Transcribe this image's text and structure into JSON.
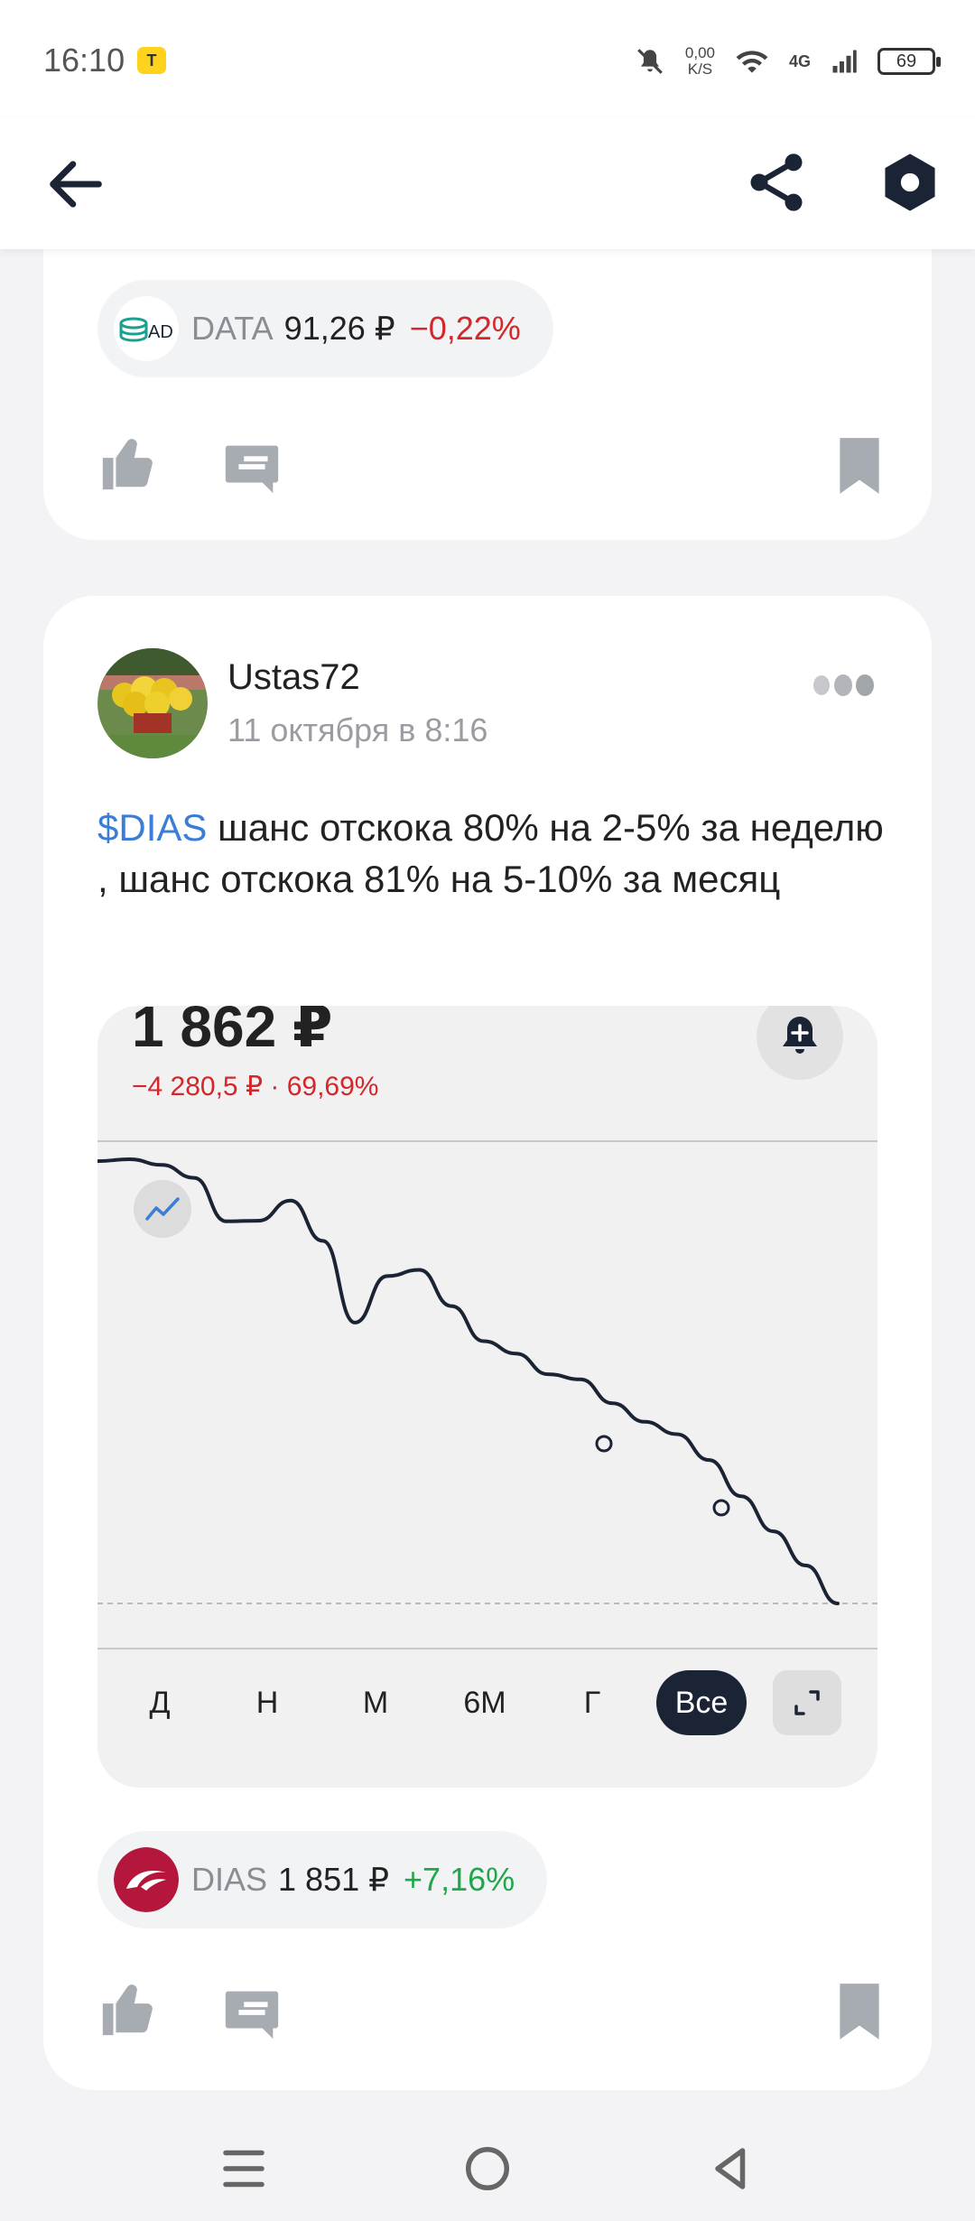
{
  "status_bar": {
    "time": "16:10",
    "net_speed_value": "0,00",
    "net_speed_unit": "K/S",
    "network_type": "4G",
    "battery": "69"
  },
  "toolbar": {
    "back_icon": "arrow-left-icon",
    "share_icon": "share-icon",
    "settings_icon": "hexagon-settings-icon"
  },
  "previous_post": {
    "ticker": {
      "name": "DATA",
      "price": "91,26 ₽",
      "change": "−0,22%",
      "change_color": "#d3272b"
    }
  },
  "post": {
    "author": "Ustas72",
    "date": "11 октября в 8:16",
    "mention": "$DIAS",
    "text": " шанс отскока 80% на 2-5% за неделю , шанс отскока 81% на 5-10% за месяц",
    "chart": {
      "price": "1 862 ₽",
      "change": "−4 280,5 ₽ · 69,69%",
      "ranges": [
        "Д",
        "Н",
        "М",
        "6М",
        "Г",
        "Все"
      ],
      "active_range": "Все"
    },
    "ticker": {
      "name": "DIAS",
      "price": "1 851 ₽",
      "change": "+7,16%",
      "change_color": "#1fa74a"
    }
  },
  "chart_data": {
    "type": "line",
    "title": "",
    "xlabel": "",
    "ylabel": "",
    "series": [
      {
        "values": [
          6142,
          6160,
          6105,
          5980,
          5560,
          5565,
          5760,
          5370,
          4580,
          5030,
          5090,
          4740,
          4400,
          4280,
          4080,
          4030,
          3800,
          3620,
          3500,
          3250,
          2900,
          2560,
          2230,
          1862
        ]
      }
    ],
    "grid": "horizontal",
    "colors": {
      "line": "#1b2434",
      "negative": "#d3272b",
      "positive": "#1fa74a"
    }
  },
  "nav_bar": {
    "icons": [
      "menu-icon",
      "home-circle-icon",
      "back-triangle-icon"
    ]
  }
}
